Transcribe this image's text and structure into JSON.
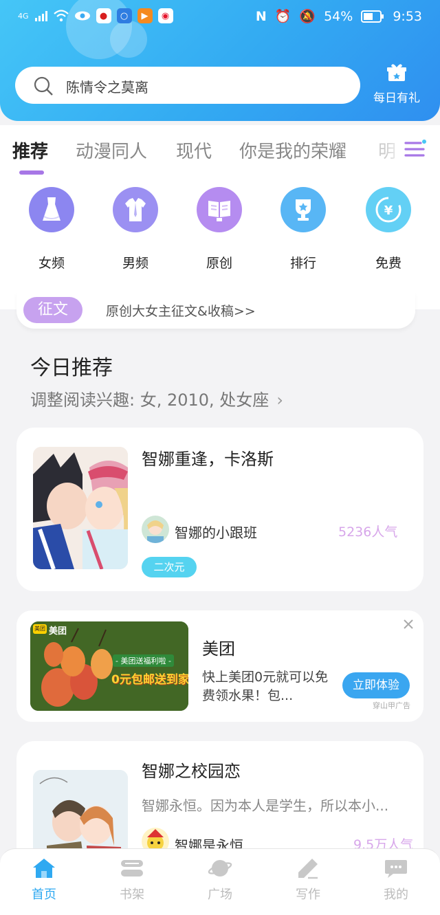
{
  "status_bar": {
    "signal": "4G",
    "battery": "54%",
    "time": "9:53"
  },
  "header": {
    "search_placeholder": "陈情令之莫离",
    "gift_label": "每日有礼"
  },
  "tabs": [
    {
      "label": "推荐",
      "active": true
    },
    {
      "label": "动漫同人"
    },
    {
      "label": "现代"
    },
    {
      "label": "你是我的荣耀"
    },
    {
      "label": "明"
    }
  ],
  "categories": [
    {
      "label": "女频",
      "icon": "dress-icon",
      "color": "#8c86f0"
    },
    {
      "label": "男频",
      "icon": "shirt-icon",
      "color": "#9b90f2"
    },
    {
      "label": "原创",
      "icon": "book-icon",
      "color": "#b58cf0"
    },
    {
      "label": "排行",
      "icon": "trophy-icon",
      "color": "#58b6f5"
    },
    {
      "label": "免费",
      "icon": "yuan-icon",
      "color": "#63d0f5"
    }
  ],
  "banner": {
    "tag": "征文",
    "text": "原创大女主征文&收稿>>"
  },
  "section": {
    "title": "今日推荐",
    "subtitle": "调整阅读兴趣: 女, 2010, 处女座"
  },
  "books": [
    {
      "title": "智娜重逢，卡洛斯",
      "author": "智娜的小跟班",
      "popularity": "5236人气",
      "tag": "二次元"
    },
    {
      "title": "智娜之校园恋",
      "description": "智娜永恒。因为本人是学生，所以本小...",
      "author": "智娜是永恒",
      "popularity": "9.5万人气"
    }
  ],
  "ad": {
    "title": "美团",
    "description": "快上美团0元就可以免费领水果！包...",
    "cta": "立即体验",
    "source": "穿山甲广告",
    "image_brand": "美团",
    "image_line1": "- 美团送福利啦 -",
    "image_line2": "0元包邮送到家"
  },
  "bottom_nav": [
    {
      "label": "首页",
      "icon": "home-icon",
      "active": true
    },
    {
      "label": "书架",
      "icon": "bookshelf-icon"
    },
    {
      "label": "广场",
      "icon": "planet-icon"
    },
    {
      "label": "写作",
      "icon": "pen-icon"
    },
    {
      "label": "我的",
      "icon": "chat-bubble-icon"
    }
  ],
  "colors": {
    "accent": "#2fa9f1",
    "purple": "#a777e6",
    "popularity": "#d7a6ea",
    "tag": "#55d3f0"
  }
}
